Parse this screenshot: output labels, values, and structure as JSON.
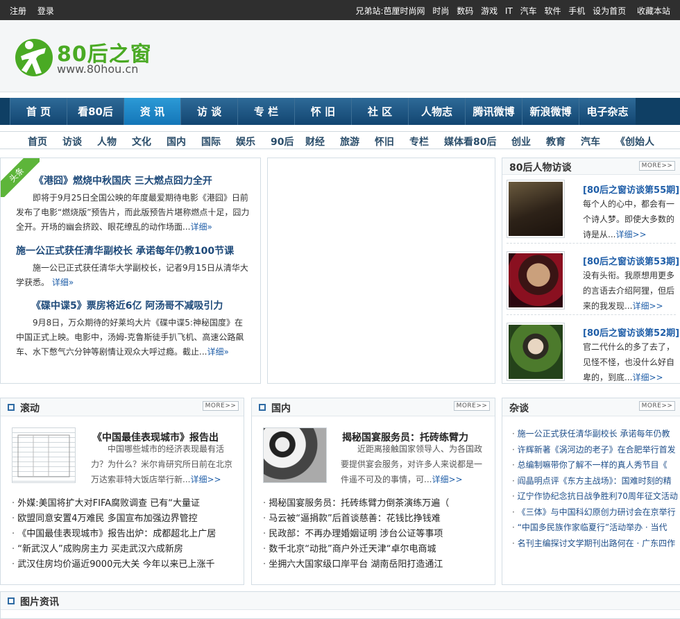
{
  "topbar": {
    "register": "注册",
    "login": "登录",
    "brother_label": "兄弟站:",
    "brother_links": [
      "芭厘时尚网",
      "时尚",
      "数码",
      "游戏",
      "IT",
      "汽车",
      "软件",
      "手机"
    ],
    "set_home": "设为首页",
    "bookmark": "收藏本站"
  },
  "logo": {
    "name": "80后之窗",
    "url": "www.80hou.cn"
  },
  "main_nav": [
    "首 页",
    "看80后",
    "资 讯",
    "访 谈",
    "专 栏",
    "怀 旧",
    "社 区",
    "人物志",
    "腾讯微博",
    "新浪微博",
    "电子杂志"
  ],
  "main_nav_active": 2,
  "sub_nav": [
    "首页",
    "访谈",
    "人物",
    "文化",
    "国内",
    "国际",
    "娱乐",
    "90后",
    "财经",
    "旅游",
    "怀旧",
    "专栏",
    "媒体看80后",
    "创业",
    "教育",
    "汽车",
    "《创始人"
  ],
  "headline": {
    "ribbon": "头条",
    "more": "详细»",
    "items": [
      {
        "title": "《港囧》燃烧中秋国庆 三大燃点囧力全开",
        "desc": "即将于9月25日全国公映的年度最爱期待电影《港囧》日前发布了电影“燃烧版”预告片，而此版预告片堪称燃点十足，囧力全开。开场的幽会挤跤、眼花缭乱的动作场面..."
      },
      {
        "title": "施一公正式获任清华副校长 承诺每年仍教100节课",
        "desc": "施一公已正式获任清华大学副校长，记者9月15日从清华大学获悉。"
      },
      {
        "title": "《碟中谍5》票房将近6亿 阿汤哥不减吸引力",
        "desc": "9月8日，万众期待的好莱坞大片《碟中谍5:神秘国度》在中国正式上映。电影中，汤姆-克鲁斯徒手扒飞机、高速公路飙车、水下憋气六分钟等剧情让观众大呼过瘾。截止..."
      }
    ]
  },
  "interviews": {
    "title": "80后人物访谈",
    "more": "MORE>>",
    "link": "详细>>",
    "items": [
      {
        "title": "[80后之窗访谈第55期]",
        "desc": "每个人的心中，都会有一个诗人梦。即使大多数的诗是从..."
      },
      {
        "title": "[80后之窗访谈第53期]",
        "desc": "没有头衔。我原想用更多的言语去介绍阿狸，但后来的我发现..."
      },
      {
        "title": "[80后之窗访谈第52期]",
        "desc": "官二代什么的多了去了，见怪不怪，也没什么好自卑的，到底..."
      }
    ]
  },
  "columns": {
    "gundong": {
      "title": "滚动",
      "more": "MORE>>",
      "feature_title": "《中国最佳表现城市》报告出",
      "feature_desc": "中国哪些城市的经济表现最有活力？为什么？米尔肯研究所日前在北京万达索菲特大饭店举行新...",
      "feature_link": "详细>>",
      "list": [
        "外媒:美国将扩大对FIFA腐败调查 已有“大量证",
        "欧盟同意安置4万难民 多国宣布加强边界管控",
        "《中国最佳表现城市》报告出炉：成都超北上广居",
        "“新武汉人”成购房主力 买走武汉六成新房",
        "武汉住房均价逼近9000元大关 今年以来已上涨千"
      ]
    },
    "guonei": {
      "title": "国内",
      "more": "MORE>>",
      "feature_title": "揭秘国宴服务员：托砖练臂力",
      "feature_desc": "近距离接触国家领导人、为各国政要提供宴会服务，对许多人来说都是一件遥不可及的事情，可...",
      "feature_link": "详细>>",
      "list": [
        "揭秘国宴服务员：托砖练臂力倒茶演练万遍（",
        "马云被“逼捐款”后首谈慈善：花钱比挣钱难",
        "民政部：不再办理婚姻证明 涉台公证等事项",
        "数千北京“动批”商户外迁天津“卓尔电商城",
        "坐拥六大国家级口岸平台 湖南岳阳打造通江"
      ]
    },
    "zatan": {
      "title": "杂谈",
      "more": "MORE>>",
      "list": [
        "施一公正式获任清华副校长 承诺每年仍教",
        "许辉新著《涡河边的老子》在合肥举行首发",
        "总编制嘛带你了解不一样的真人秀节目《",
        "阎晶明点评《东方主战场》：国难时刻的精",
        "辽宁作协纪念抗日战争胜利70周年征文活动",
        "《三体》与中国科幻原创力研讨会在京举行",
        "“中国多民族作家临夏行”活动举办 · 当代",
        "名刊主编探讨文学期刊出路何在 · 广东四作"
      ]
    }
  },
  "pictures": {
    "title": "图片资讯"
  },
  "colors": {
    "nav_bg": "#124571",
    "nav_active": "#1476b8",
    "link_blue": "#1f5ea8",
    "logo_green": "#4aaa24"
  }
}
